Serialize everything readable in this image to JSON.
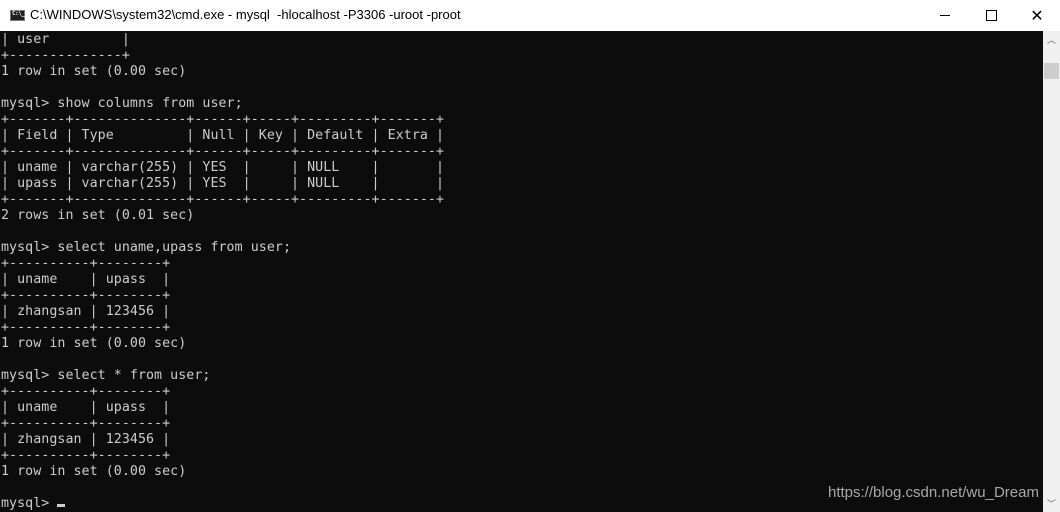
{
  "window": {
    "title": "C:\\WINDOWS\\system32\\cmd.exe - mysql  -hlocalhost -P3306 -uroot -proot",
    "icon": "cmd-icon",
    "controls": {
      "minimize": "minimize-icon",
      "maximize": "maximize-icon",
      "close": "close-icon"
    },
    "close_glyph": "✕"
  },
  "console": {
    "lines": [
      "| user         |",
      "+--------------+",
      "1 row in set (0.00 sec)",
      "",
      "mysql> show columns from user;",
      "+-------+--------------+------+-----+---------+-------+",
      "| Field | Type         | Null | Key | Default | Extra |",
      "+-------+--------------+------+-----+---------+-------+",
      "| uname | varchar(255) | YES  |     | NULL    |       |",
      "| upass | varchar(255) | YES  |     | NULL    |       |",
      "+-------+--------------+------+-----+---------+-------+",
      "2 rows in set (0.01 sec)",
      "",
      "mysql> select uname,upass from user;",
      "+----------+--------+",
      "| uname    | upass  |",
      "+----------+--------+",
      "| zhangsan | 123456 |",
      "+----------+--------+",
      "1 row in set (0.00 sec)",
      "",
      "mysql> select * from user;",
      "+----------+--------+",
      "| uname    | upass  |",
      "+----------+--------+",
      "| zhangsan | 123456 |",
      "+----------+--------+",
      "1 row in set (0.00 sec)",
      "",
      "mysql> "
    ]
  },
  "scrollbar": {
    "up_glyph": "︿",
    "down_glyph": "﹀"
  },
  "watermark": "https://blog.csdn.net/wu_Dream"
}
